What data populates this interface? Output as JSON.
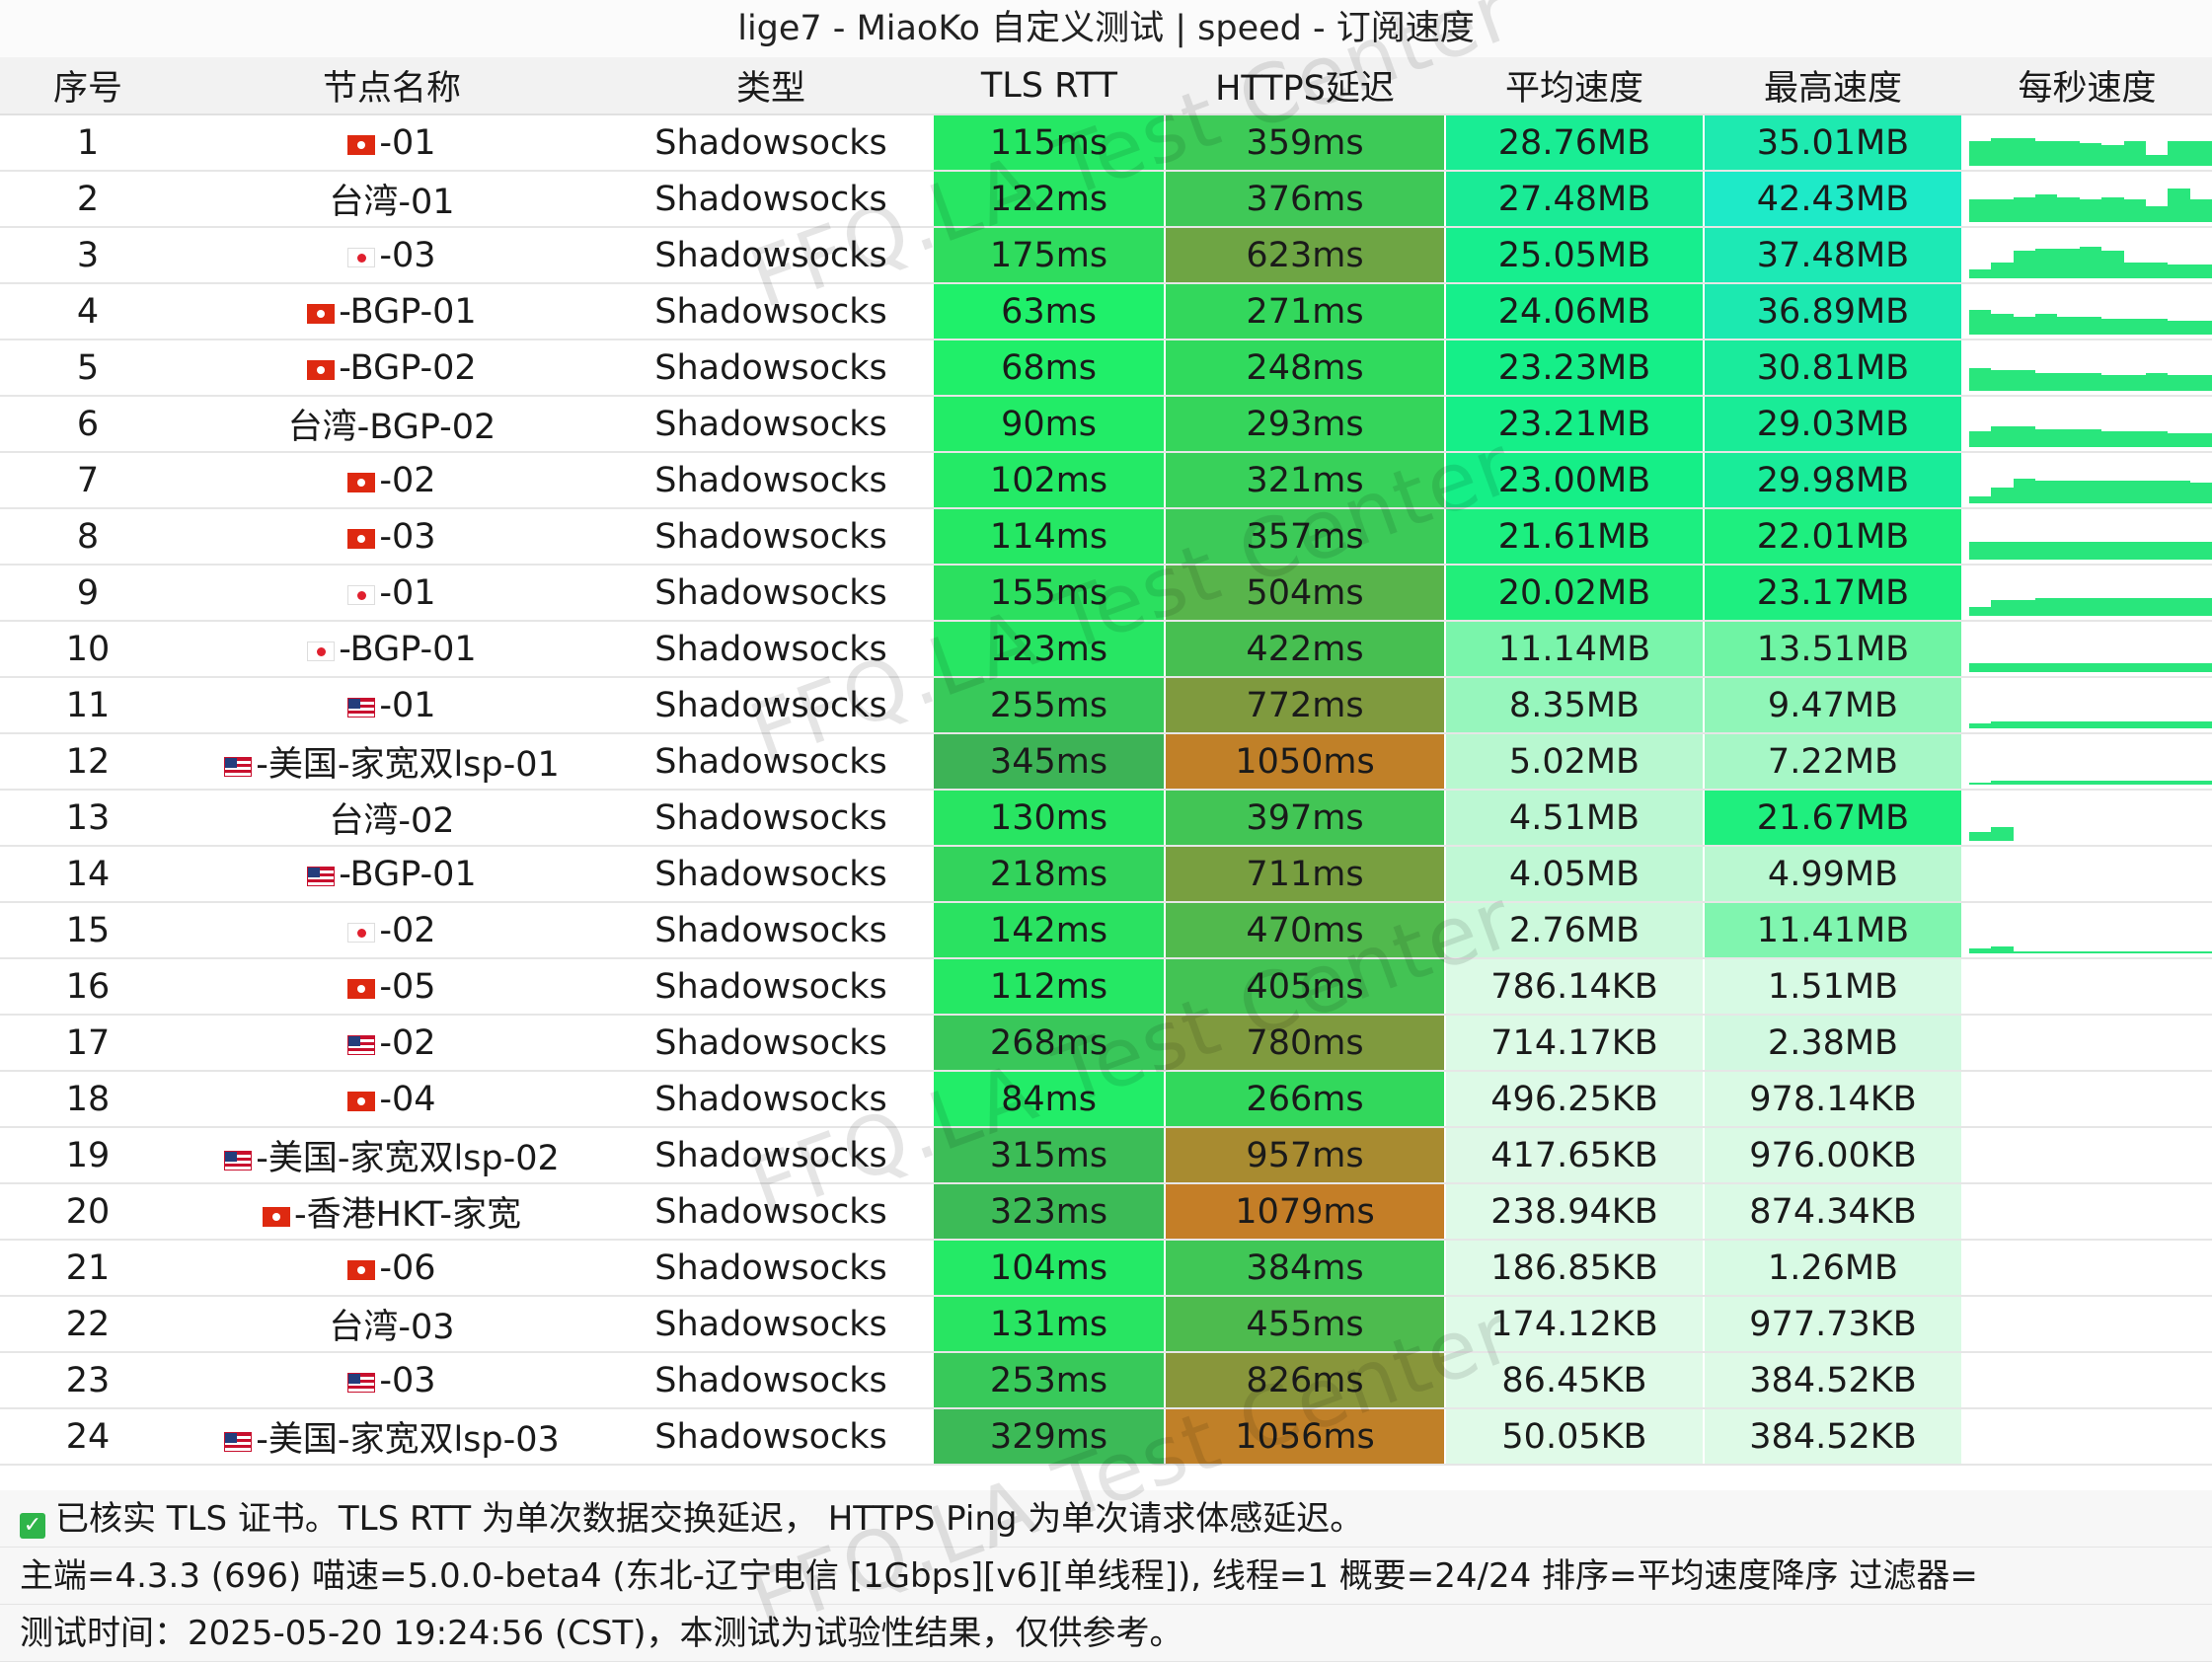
{
  "title": "lige7 - MiaoKo 自定义测试 | speed - 订阅速度",
  "columns": [
    "序号",
    "节点名称",
    "类型",
    "TLS RTT",
    "HTTPS延迟",
    "平均速度",
    "最高速度",
    "每秒速度"
  ],
  "watermark": "FFQ.LA Test Center",
  "colors": {
    "tls": [
      "#1df16a",
      "#2fe25e",
      "#36c958",
      "#3ab351"
    ],
    "https": [
      "#34d65c",
      "#4ab84c",
      "#7a9b3e",
      "#c17f27"
    ],
    "speed_gradient": [
      "#1ee9c6",
      "#14f289",
      "#8cf5b7",
      "#c5f8d8",
      "#e2fbeb"
    ]
  },
  "rows": [
    {
      "no": "1",
      "flag": "hk",
      "name": "-01",
      "type": "Shadowsocks",
      "tls": "115ms",
      "https": "359ms",
      "avg": "28.76MB",
      "max": "35.01MB",
      "tls_c": "#25e864",
      "https_c": "#3dca57",
      "avg_c": "#19ed94",
      "max_c": "#1eeab0",
      "spark": [
        0.55,
        0.6,
        0.6,
        0.55,
        0.55,
        0.5,
        0.45,
        0.55,
        0.25,
        0.55,
        0.55
      ]
    },
    {
      "no": "2",
      "flag": "",
      "name": "台湾-01",
      "type": "Shadowsocks",
      "tls": "122ms",
      "https": "376ms",
      "avg": "27.48MB",
      "max": "42.43MB",
      "tls_c": "#27e663",
      "https_c": "#3fc857",
      "avg_c": "#1aeb96",
      "max_c": "#1eeac8",
      "spark": [
        0.5,
        0.5,
        0.55,
        0.6,
        0.55,
        0.5,
        0.55,
        0.5,
        0.35,
        0.75,
        0.5
      ]
    },
    {
      "no": "3",
      "flag": "jp",
      "name": "-03",
      "type": "Shadowsocks",
      "tls": "175ms",
      "https": "623ms",
      "avg": "25.05MB",
      "max": "37.48MB",
      "tls_c": "#2fdc5e",
      "https_c": "#6ea544",
      "avg_c": "#17ee8e",
      "max_c": "#1de9b5",
      "spark": [
        0.2,
        0.35,
        0.6,
        0.65,
        0.65,
        0.7,
        0.6,
        0.35,
        0.35,
        0.3,
        0.3
      ]
    },
    {
      "no": "4",
      "flag": "hk",
      "name": "-BGP-01",
      "type": "Shadowsocks",
      "tls": "63ms",
      "https": "271ms",
      "avg": "24.06MB",
      "max": "36.89MB",
      "tls_c": "#1ff06a",
      "https_c": "#33d75c",
      "avg_c": "#16ef8b",
      "max_c": "#1ce9b0",
      "spark": [
        0.55,
        0.45,
        0.4,
        0.45,
        0.4,
        0.4,
        0.35,
        0.35,
        0.35,
        0.3,
        0.3
      ]
    },
    {
      "no": "5",
      "flag": "hk",
      "name": "-BGP-02",
      "type": "Shadowsocks",
      "tls": "68ms",
      "https": "248ms",
      "avg": "23.23MB",
      "max": "30.81MB",
      "tls_c": "#20ef69",
      "https_c": "#30da5d",
      "avg_c": "#15ef88",
      "max_c": "#1aeb9c",
      "spark": [
        0.5,
        0.45,
        0.45,
        0.4,
        0.4,
        0.4,
        0.35,
        0.35,
        0.4,
        0.35,
        0.35
      ]
    },
    {
      "no": "6",
      "flag": "",
      "name": "台湾-BGP-02",
      "type": "Shadowsocks",
      "tls": "90ms",
      "https": "293ms",
      "avg": "23.21MB",
      "max": "29.03MB",
      "tls_c": "#22ec67",
      "https_c": "#35d55b",
      "avg_c": "#15ef88",
      "max_c": "#19ec97",
      "spark": [
        0.35,
        0.45,
        0.45,
        0.4,
        0.4,
        0.4,
        0.35,
        0.35,
        0.35,
        0.3,
        0.3
      ]
    },
    {
      "no": "7",
      "flag": "hk",
      "name": "-02",
      "type": "Shadowsocks",
      "tls": "102ms",
      "https": "321ms",
      "avg": "23.00MB",
      "max": "29.98MB",
      "tls_c": "#24ea66",
      "https_c": "#38d15a",
      "avg_c": "#15ef87",
      "max_c": "#19ec99",
      "spark": [
        0.15,
        0.35,
        0.55,
        0.5,
        0.5,
        0.5,
        0.5,
        0.5,
        0.5,
        0.5,
        0.45
      ]
    },
    {
      "no": "8",
      "flag": "hk",
      "name": "-03",
      "type": "Shadowsocks",
      "tls": "114ms",
      "https": "357ms",
      "avg": "21.61MB",
      "max": "22.01MB",
      "tls_c": "#25e864",
      "https_c": "#3cca58",
      "avg_c": "#1cef80",
      "max_c": "#1eef7f",
      "spark": [
        0.4,
        0.4,
        0.4,
        0.4,
        0.4,
        0.4,
        0.4,
        0.4,
        0.4,
        0.4,
        0.4
      ]
    },
    {
      "no": "9",
      "flag": "jp",
      "name": "-01",
      "type": "Shadowsocks",
      "tls": "155ms",
      "https": "504ms",
      "avg": "20.02MB",
      "max": "23.17MB",
      "tls_c": "#2be05f",
      "https_c": "#58b44b",
      "avg_c": "#22ee7a",
      "max_c": "#1eef80",
      "spark": [
        0.2,
        0.35,
        0.35,
        0.4,
        0.4,
        0.4,
        0.4,
        0.4,
        0.4,
        0.4,
        0.4
      ]
    },
    {
      "no": "10",
      "flag": "jp",
      "name": "-BGP-01",
      "type": "Shadowsocks",
      "tls": "123ms",
      "https": "422ms",
      "avg": "11.14MB",
      "max": "13.51MB",
      "tls_c": "#27e663",
      "https_c": "#47bf51",
      "avg_c": "#7af5ab",
      "max_c": "#6ff4a4",
      "spark": [
        0.2,
        0.2,
        0.2,
        0.2,
        0.2,
        0.2,
        0.2,
        0.2,
        0.2,
        0.2,
        0.2
      ]
    },
    {
      "no": "11",
      "flag": "us",
      "name": "-01",
      "type": "Shadowsocks",
      "tls": "255ms",
      "https": "772ms",
      "avg": "8.35MB",
      "max": "9.47MB",
      "tls_c": "#38c95a",
      "https_c": "#7f9a3e",
      "avg_c": "#97f6bd",
      "max_c": "#90f6b8",
      "spark": [
        0.1,
        0.15,
        0.15,
        0.15,
        0.15,
        0.15,
        0.15,
        0.15,
        0.15,
        0.15,
        0.15
      ]
    },
    {
      "no": "12",
      "flag": "us",
      "name": "-美国-家宽双lsp-01",
      "type": "Shadowsocks",
      "tls": "345ms",
      "https": "1050ms",
      "avg": "5.02MB",
      "max": "7.22MB",
      "tls_c": "#3db356",
      "https_c": "#c08028",
      "avg_c": "#b8f8d0",
      "max_c": "#a6f7c6",
      "spark": [
        0.05,
        0.08,
        0.08,
        0.08,
        0.08,
        0.08,
        0.08,
        0.08,
        0.08,
        0.08,
        0.08
      ]
    },
    {
      "no": "13",
      "flag": "",
      "name": "台湾-02",
      "type": "Shadowsocks",
      "tls": "130ms",
      "https": "397ms",
      "avg": "4.51MB",
      "max": "21.67MB",
      "tls_c": "#28e562",
      "https_c": "#42c555",
      "avg_c": "#bcf8d3",
      "max_c": "#1fef7e",
      "spark": [
        0.2,
        0.3,
        0,
        0,
        0,
        0,
        0,
        0,
        0,
        0,
        0
      ]
    },
    {
      "no": "14",
      "flag": "us",
      "name": "-BGP-01",
      "type": "Shadowsocks",
      "tls": "218ms",
      "https": "711ms",
      "avg": "4.05MB",
      "max": "4.99MB",
      "tls_c": "#33d35c",
      "https_c": "#789f40",
      "avg_c": "#c0f8d5",
      "max_c": "#baf8d1",
      "spark": [
        0,
        0,
        0,
        0,
        0,
        0,
        0,
        0,
        0,
        0,
        0
      ]
    },
    {
      "no": "15",
      "flag": "jp",
      "name": "-02",
      "type": "Shadowsocks",
      "tls": "142ms",
      "https": "470ms",
      "avg": "2.76MB",
      "max": "11.41MB",
      "tls_c": "#2ae261",
      "https_c": "#51b94d",
      "avg_c": "#ccf9dc",
      "max_c": "#80f5af",
      "spark": [
        0.1,
        0.15,
        0.05,
        0.05,
        0.05,
        0.05,
        0.05,
        0.05,
        0.05,
        0.05,
        0.05
      ]
    },
    {
      "no": "16",
      "flag": "hk",
      "name": "-05",
      "type": "Shadowsocks",
      "tls": "112ms",
      "https": "405ms",
      "avg": "786.14KB",
      "max": "1.51MB",
      "tls_c": "#25e864",
      "https_c": "#43c354",
      "avg_c": "#dcfae6",
      "max_c": "#d7fae4",
      "spark": []
    },
    {
      "no": "17",
      "flag": "us",
      "name": "-02",
      "type": "Shadowsocks",
      "tls": "268ms",
      "https": "780ms",
      "avg": "714.17KB",
      "max": "2.38MB",
      "tls_c": "#39c75a",
      "https_c": "#7f9a3e",
      "avg_c": "#dcfae6",
      "max_c": "#d2f9e1",
      "spark": []
    },
    {
      "no": "18",
      "flag": "hk",
      "name": "-04",
      "type": "Shadowsocks",
      "tls": "84ms",
      "https": "266ms",
      "avg": "496.25KB",
      "max": "978.14KB",
      "tls_c": "#22ed68",
      "https_c": "#32d85c",
      "avg_c": "#ddfae7",
      "max_c": "#dafae5",
      "spark": []
    },
    {
      "no": "19",
      "flag": "us",
      "name": "-美国-家宽双lsp-02",
      "type": "Shadowsocks",
      "tls": "315ms",
      "https": "957ms",
      "avg": "417.65KB",
      "max": "976.00KB",
      "tls_c": "#3cbd57",
      "https_c": "#a88b30",
      "avg_c": "#def9e7",
      "max_c": "#dafae5",
      "spark": []
    },
    {
      "no": "20",
      "flag": "hk",
      "name": "-香港HKT-家宽",
      "type": "Shadowsocks",
      "tls": "323ms",
      "https": "1079ms",
      "avg": "238.94KB",
      "max": "874.34KB",
      "tls_c": "#3cbb57",
      "https_c": "#c47e27",
      "avg_c": "#dffae8",
      "max_c": "#dbfae6",
      "spark": []
    },
    {
      "no": "21",
      "flag": "hk",
      "name": "-06",
      "type": "Shadowsocks",
      "tls": "104ms",
      "https": "384ms",
      "avg": "186.85KB",
      "max": "1.26MB",
      "tls_c": "#24ea66",
      "https_c": "#40c756",
      "avg_c": "#dffae8",
      "max_c": "#d8fae4",
      "spark": []
    },
    {
      "no": "22",
      "flag": "",
      "name": "台湾-03",
      "type": "Shadowsocks",
      "tls": "131ms",
      "https": "455ms",
      "avg": "174.12KB",
      "max": "977.73KB",
      "tls_c": "#28e562",
      "https_c": "#4dbb4e",
      "avg_c": "#dffae8",
      "max_c": "#dafae5",
      "spark": []
    },
    {
      "no": "23",
      "flag": "us",
      "name": "-03",
      "type": "Shadowsocks",
      "tls": "253ms",
      "https": "826ms",
      "avg": "86.45KB",
      "max": "384.52KB",
      "tls_c": "#38c95a",
      "https_c": "#88963b",
      "avg_c": "#e0fae8",
      "max_c": "#defae7",
      "spark": []
    },
    {
      "no": "24",
      "flag": "us",
      "name": "-美国-家宽双lsp-03",
      "type": "Shadowsocks",
      "tls": "329ms",
      "https": "1056ms",
      "avg": "50.05KB",
      "max": "384.52KB",
      "tls_c": "#3cba57",
      "https_c": "#c08028",
      "avg_c": "#e0fae8",
      "max_c": "#defae7",
      "spark": []
    }
  ],
  "footer": {
    "line1": "已核实 TLS 证书。TLS RTT 为单次数据交换延迟， HTTPS Ping 为单次请求体感延迟。",
    "line2": "主端=4.3.3 (696) 喵速=5.0.0-beta4 (东北-辽宁电信 [1Gbps][v6][单线程]), 线程=1 概要=24/24 排序=平均速度降序 过滤器=",
    "line3": "测试时间：2025-05-20 19:24:56 (CST)，本测试为试验性结果，仅供参考。"
  }
}
